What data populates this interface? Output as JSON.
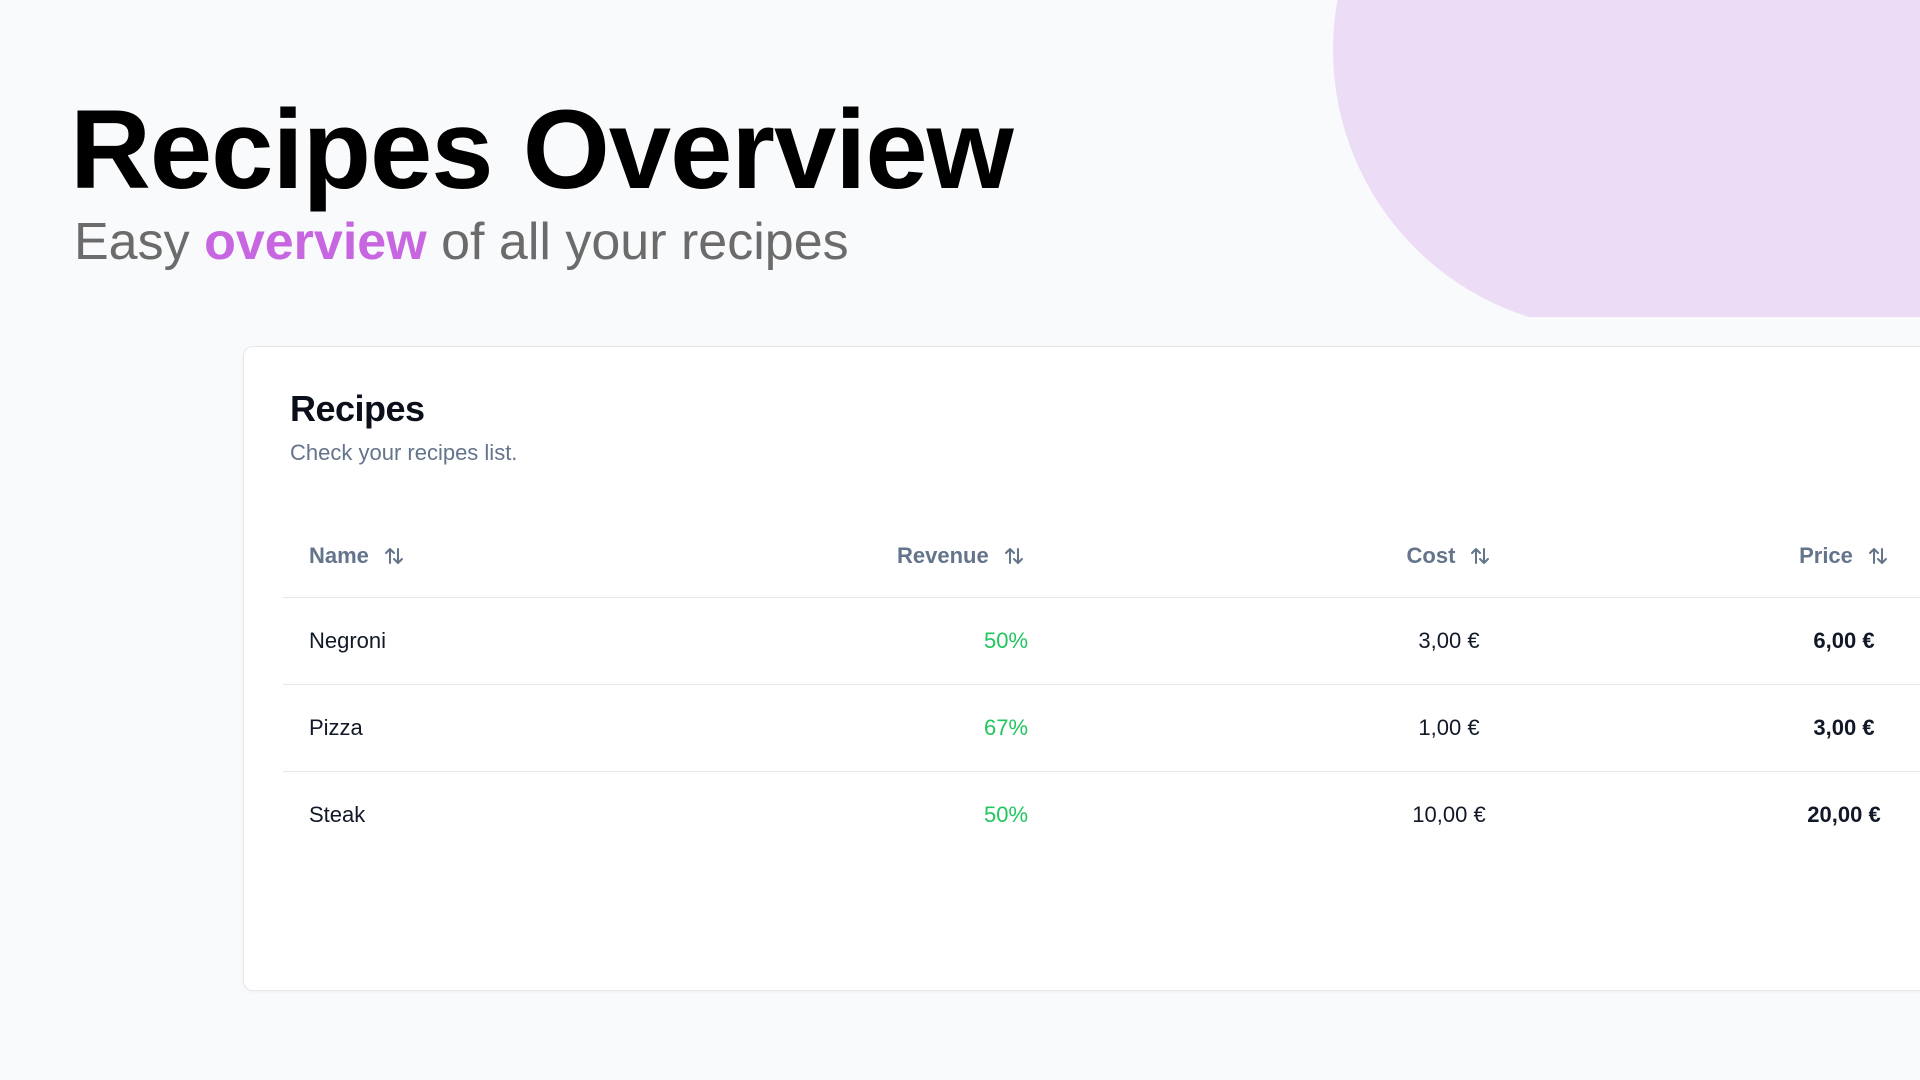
{
  "hero": {
    "title": "Recipes Overview",
    "subtitle_before": "Easy",
    "subtitle_accent": "overview",
    "subtitle_after": "of all your recipes",
    "accent_color": "#c766e0"
  },
  "card": {
    "title": "Recipes",
    "subtitle": "Check your recipes list."
  },
  "table": {
    "columns": [
      {
        "label": "Name",
        "sort_icon": "sort-arrows-icon"
      },
      {
        "label": "Revenue",
        "sort_icon": "sort-arrows-icon"
      },
      {
        "label": "Cost",
        "sort_icon": "sort-arrows-icon"
      },
      {
        "label": "Price",
        "sort_icon": "sort-arrows-icon"
      }
    ],
    "rows": [
      {
        "name": "Negroni",
        "revenue": "50%",
        "cost": "3,00 €",
        "price": "6,00 €"
      },
      {
        "name": "Pizza",
        "revenue": "67%",
        "cost": "1,00 €",
        "price": "3,00 €"
      },
      {
        "name": "Steak",
        "revenue": "50%",
        "cost": "10,00 €",
        "price": "20,00 €"
      }
    ]
  },
  "colors": {
    "revenue_positive": "#22c55e",
    "decor_blob": "#eddcf5"
  }
}
